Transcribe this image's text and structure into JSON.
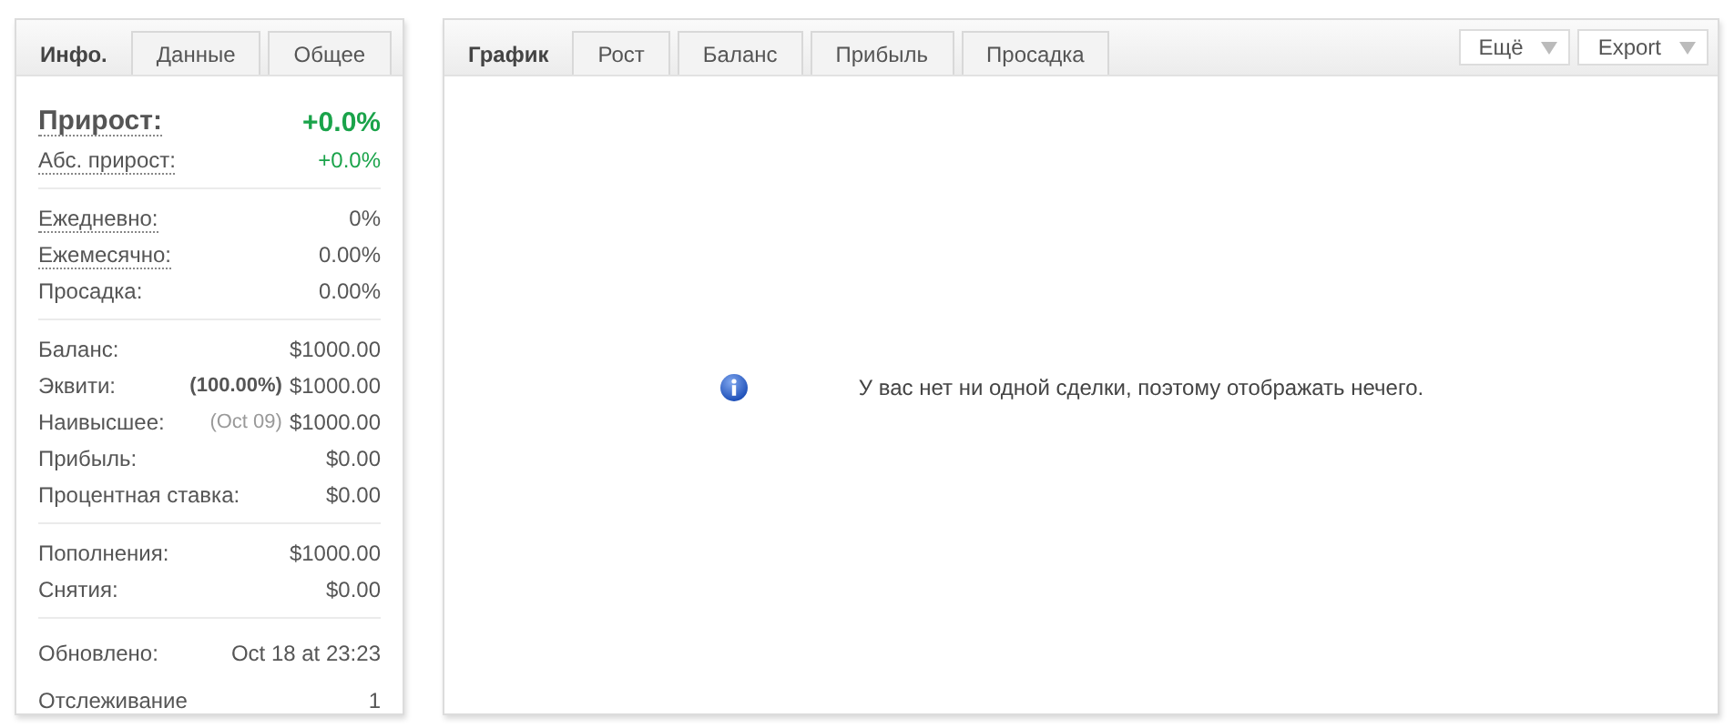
{
  "info_panel": {
    "tabs": [
      {
        "label": "Инфо.",
        "selected": true
      },
      {
        "label": "Данные",
        "selected": false
      },
      {
        "label": "Общее",
        "selected": false
      }
    ],
    "sections": [
      {
        "rows": [
          {
            "kind": "headline",
            "label": "Прирост:",
            "hint": true,
            "value": "+0.0%",
            "positive": true
          },
          {
            "kind": "plain",
            "label": "Абс. прирост:",
            "hint": true,
            "value": "+0.0%",
            "positive": true
          }
        ]
      },
      {
        "rows": [
          {
            "kind": "plain",
            "label": "Ежедневно:",
            "hint": true,
            "value": "0%",
            "positive": false
          },
          {
            "kind": "plain",
            "label": "Ежемесячно:",
            "hint": true,
            "value": "0.00%",
            "positive": false
          },
          {
            "kind": "plain",
            "label": "Просадка:",
            "hint": false,
            "value": "0.00%",
            "positive": false
          }
        ]
      },
      {
        "rows": [
          {
            "kind": "plain",
            "label": "Баланс:",
            "hint": false,
            "value": "$1000.00",
            "positive": false
          },
          {
            "kind": "plain",
            "label": "Эквити:",
            "hint": false,
            "note": "(100.00%)",
            "note_muted": false,
            "value": "$1000.00",
            "positive": false
          },
          {
            "kind": "plain",
            "label": "Наивысшее:",
            "hint": false,
            "note": "(Oct 09)",
            "note_muted": true,
            "value": "$1000.00",
            "positive": false
          },
          {
            "kind": "plain",
            "label": "Прибыль:",
            "hint": false,
            "value": "$0.00",
            "positive": false
          },
          {
            "kind": "plain",
            "label": "Процентная ставка:",
            "hint": false,
            "value": "$0.00",
            "positive": false
          }
        ]
      },
      {
        "rows": [
          {
            "kind": "plain",
            "label": "Пополнения:",
            "hint": false,
            "value": "$1000.00",
            "positive": false
          },
          {
            "kind": "plain",
            "label": "Снятия:",
            "hint": false,
            "value": "$0.00",
            "positive": false
          }
        ]
      },
      {
        "rows": [
          {
            "kind": "loose",
            "label": "Обновлено:",
            "hint": false,
            "value": "Oct 18 at 23:23",
            "positive": false
          },
          {
            "kind": "loose",
            "label": "Отслеживание",
            "hint": false,
            "value": "1",
            "positive": false
          }
        ]
      }
    ]
  },
  "chart_panel": {
    "tabs": [
      {
        "label": "График",
        "selected": true
      },
      {
        "label": "Рост",
        "selected": false
      },
      {
        "label": "Баланс",
        "selected": false
      },
      {
        "label": "Прибыль",
        "selected": false
      },
      {
        "label": "Просадка",
        "selected": false
      }
    ],
    "menus": [
      "Ещё",
      "Export"
    ],
    "message": "У вас нет ни одной сделки, поэтому отображать нечего."
  }
}
